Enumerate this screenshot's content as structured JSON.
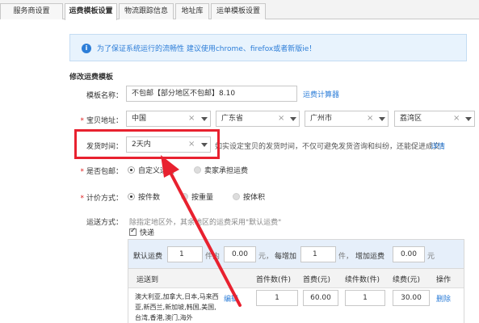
{
  "tabs": [
    {
      "label": "服务商设置",
      "active": false
    },
    {
      "label": "运费模板设置",
      "active": true
    },
    {
      "label": "物流跟踪信息",
      "active": false
    },
    {
      "label": "地址库",
      "active": false
    },
    {
      "label": "运单模板设置",
      "active": false
    }
  ],
  "notice": {
    "text": "为了保证系统运行的流畅性 建议使用chrome、firefox或者新版ie！"
  },
  "section_title": "修改运费模板",
  "form": {
    "template_name": {
      "label": "模板名称：",
      "value": "不包邮【部分地区不包邮】8.10",
      "calc_link": "运费计算器"
    },
    "origin": {
      "label": "宝贝地址：",
      "country": "中国",
      "province": "广东省",
      "city": "广州市",
      "district": "荔湾区"
    },
    "ship_time": {
      "label": "发货时间：",
      "value": "2天内",
      "hint": "如实设定宝贝的发货时间，不仅可避免发货咨询和纠纷，还能促进成交！",
      "detail_link": "详情"
    },
    "free_shipping": {
      "label": "是否包邮：",
      "options": [
        "自定义运费",
        "卖家承担运费"
      ],
      "selected": 0
    },
    "pricing": {
      "label": "计价方式：",
      "options": [
        "按件数",
        "按重量",
        "按体积"
      ],
      "selected": 0
    },
    "delivery": {
      "label": "运送方式：",
      "hint": "除指定地区外，其余地区的运费采用\"默认运费\"",
      "express_label": "快递",
      "express_checked": true,
      "default_row": {
        "default_label": "默认运费",
        "first_qty": "1",
        "unit1": "件内",
        "first_fee": "0.00",
        "unit2": "元，",
        "each_add_label": "每增加",
        "add_qty": "1",
        "unit3": "件，",
        "add_fee_label": "增加运费",
        "add_fee": "0.00",
        "unit4": "元"
      },
      "table": {
        "headers": [
          "运送到",
          "首件数(件)",
          "首费(元)",
          "续件数(件)",
          "续费(元)",
          "操作"
        ],
        "rows": [
          {
            "region": "澳大利亚,加拿大,日本,马来西亚,新西兰,新加坡,韩国,美国,台湾,香港,澳门,海外",
            "edit": "编辑",
            "first_qty": "1",
            "first_fee": "60.00",
            "add_qty": "1",
            "add_fee": "30.00",
            "op": "删除"
          }
        ]
      }
    }
  },
  "colors": {
    "accent": "#2d7ed8",
    "highlight": "#e8212f",
    "required": "#e02020"
  }
}
